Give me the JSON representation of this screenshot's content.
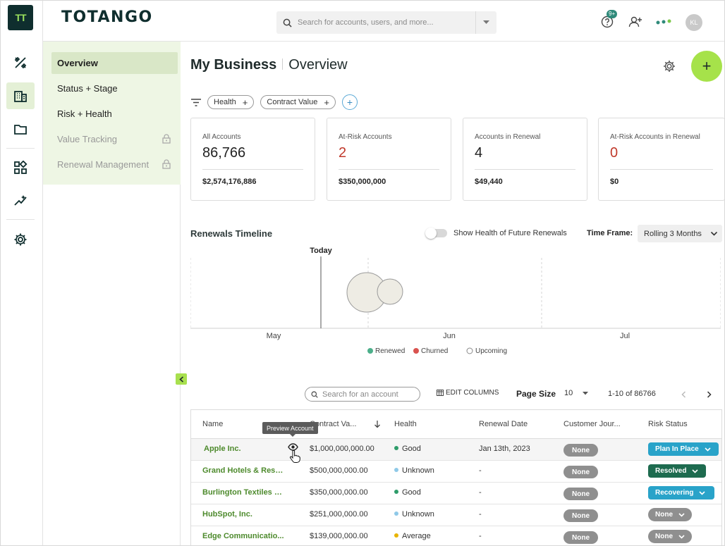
{
  "app": {
    "brand": "TOTANGO",
    "logo_text": "TT"
  },
  "header": {
    "search_placeholder": "Search for accounts, users, and more...",
    "notification_badge": "9+",
    "avatar_initials": "KL"
  },
  "rail": {
    "items": [
      "tools-icon",
      "buildings-icon",
      "folder-icon",
      "widgets-icon",
      "analytics-icon",
      "settings-icon"
    ]
  },
  "subnav": {
    "items": [
      {
        "label": "Overview",
        "active": true,
        "locked": false
      },
      {
        "label": "Status + Stage",
        "active": false,
        "locked": false
      },
      {
        "label": "Risk + Health",
        "active": false,
        "locked": false
      },
      {
        "label": "Value Tracking",
        "active": false,
        "locked": true
      },
      {
        "label": "Renewal Management",
        "active": false,
        "locked": true
      }
    ]
  },
  "page": {
    "title": "My Business",
    "subtitle": "Overview"
  },
  "filters": {
    "chips": [
      "Health",
      "Contract Value"
    ],
    "add": "+"
  },
  "kpis": [
    {
      "label": "All Accounts",
      "value": "86,766",
      "sub": "$2,574,176,886",
      "red": false
    },
    {
      "label": "At-Risk Accounts",
      "value": "2",
      "sub": "$350,000,000",
      "red": true
    },
    {
      "label": "Accounts in Renewal",
      "value": "4",
      "sub": "$49,440",
      "red": false
    },
    {
      "label": "At-Risk Accounts in Renewal",
      "value": "0",
      "sub": "$0",
      "red": true
    }
  ],
  "timeline": {
    "title": "Renewals Timeline",
    "toggle_label": "Show Health of Future Renewals",
    "toggle_on": false,
    "timeframe_label": "Time Frame:",
    "timeframe_value": "Rolling 3 Months",
    "today_label": "Today",
    "months": [
      "May",
      "Jun",
      "Jul"
    ],
    "legend": [
      {
        "label": "Renewed",
        "color": "#4caf8a"
      },
      {
        "label": "Churned",
        "color": "#d9534f"
      },
      {
        "label": "Upcoming",
        "color": "#ffffff"
      }
    ]
  },
  "table_toolbar": {
    "search_placeholder": "Search for an account",
    "edit_columns": "EDIT COLUMNS",
    "page_size_label": "Page Size",
    "page_size_value": "10",
    "range": "1-10 of 86766"
  },
  "table": {
    "columns": [
      "Name",
      "Contract Va...",
      "Health",
      "Renewal Date",
      "Customer Jour...",
      "Risk Status"
    ],
    "tooltip": "Preview Account",
    "rows": [
      {
        "name": "Apple Inc.",
        "contract": "$1,000,000,000.00",
        "health": "Good",
        "health_color": "#2e9c6a",
        "renewal": "Jan 13th, 2023",
        "journey": "None",
        "risk": "Plan In Place",
        "risk_color": "#29a3c9"
      },
      {
        "name": "Grand Hotels & Resor...",
        "contract": "$500,000,000.00",
        "health": "Unknown",
        "health_color": "#8fc9e8",
        "renewal": "-",
        "journey": "None",
        "risk": "Resolved",
        "risk_color": "#1e6b4f"
      },
      {
        "name": "Burlington Textiles Co...",
        "contract": "$350,000,000.00",
        "health": "Good",
        "health_color": "#2e9c6a",
        "renewal": "-",
        "journey": "None",
        "risk": "Recovering",
        "risk_color": "#29a3c9"
      },
      {
        "name": "HubSpot, Inc.",
        "contract": "$251,000,000.00",
        "health": "Unknown",
        "health_color": "#8fc9e8",
        "renewal": "-",
        "journey": "None",
        "risk": "None",
        "risk_color": "#8f8f8f"
      },
      {
        "name": "Edge Communicatio...",
        "contract": "$139,000,000.00",
        "health": "Average",
        "health_color": "#e8b400",
        "renewal": "-",
        "journey": "None",
        "risk": "None",
        "risk_color": "#8f8f8f"
      }
    ]
  }
}
